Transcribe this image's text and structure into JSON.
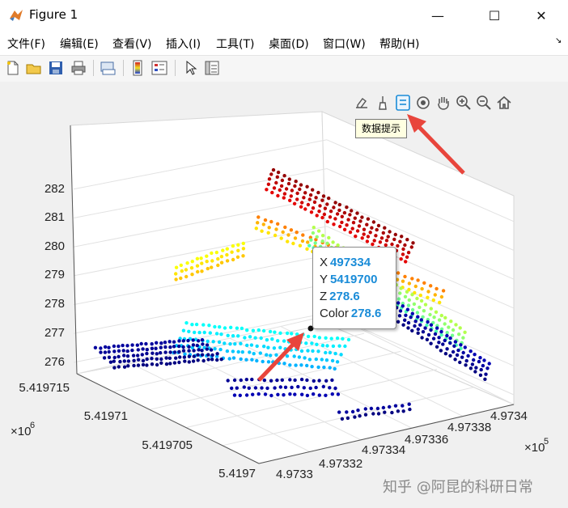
{
  "window": {
    "title": "Figure 1",
    "minimize": "—",
    "maximize": "☐",
    "close": "✕"
  },
  "menu": [
    "文件(F)",
    "编辑(E)",
    "查看(V)",
    "插入(I)",
    "工具(T)",
    "桌面(D)",
    "窗口(W)",
    "帮助(H)"
  ],
  "tooltip": "数据提示",
  "axes": {
    "z_ticks": [
      "282",
      "281",
      "280",
      "279",
      "278",
      "277",
      "276"
    ],
    "y_ticks": [
      "5.419715",
      "5.41971",
      "5.419705",
      "5.4197"
    ],
    "x_ticks": [
      "4.9733",
      "4.97332",
      "4.97334",
      "4.97336",
      "4.97338",
      "4.9734"
    ],
    "y_exponent": "×10",
    "y_exponent_power": "6",
    "x_exponent": "×10",
    "x_exponent_power": "5"
  },
  "datatip": {
    "x_label": "X",
    "x_value": "497334",
    "y_label": "Y",
    "y_value": "5419700",
    "z_label": "Z",
    "z_value": "278.6",
    "c_label": "Color",
    "c_value": "278.6"
  },
  "watermark": "知乎 @阿昆的科研日常",
  "colors": {
    "accent": "#1a8cd8",
    "arrow": "#e8453c",
    "canvas": "#f0f0f0"
  }
}
